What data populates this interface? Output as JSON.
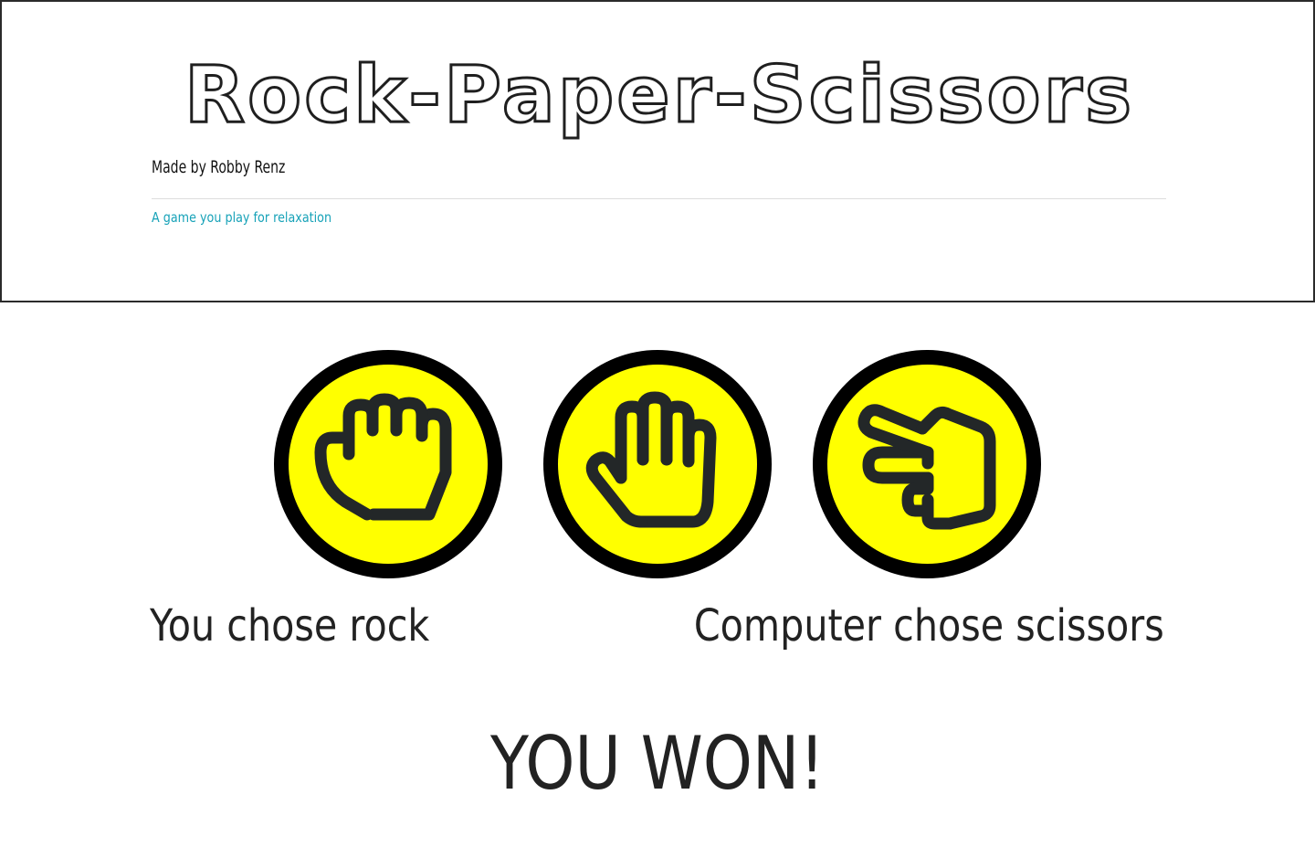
{
  "header": {
    "title": "Rock-Paper-Scissors",
    "author": "Made by Robby Renz",
    "tagline": "A game you play for relaxation"
  },
  "choices": [
    {
      "id": "rock",
      "icon": "fist-icon"
    },
    {
      "id": "paper",
      "icon": "open-hand-icon"
    },
    {
      "id": "scissors",
      "icon": "scissors-hand-icon"
    }
  ],
  "colors": {
    "choice_fill": "#ffff00",
    "choice_border": "#000000",
    "tagline": "#17a2b8"
  },
  "result": {
    "user_choice": "You chose rock",
    "computer_choice": "Computer chose scissors",
    "verdict": "YOU WON!"
  }
}
